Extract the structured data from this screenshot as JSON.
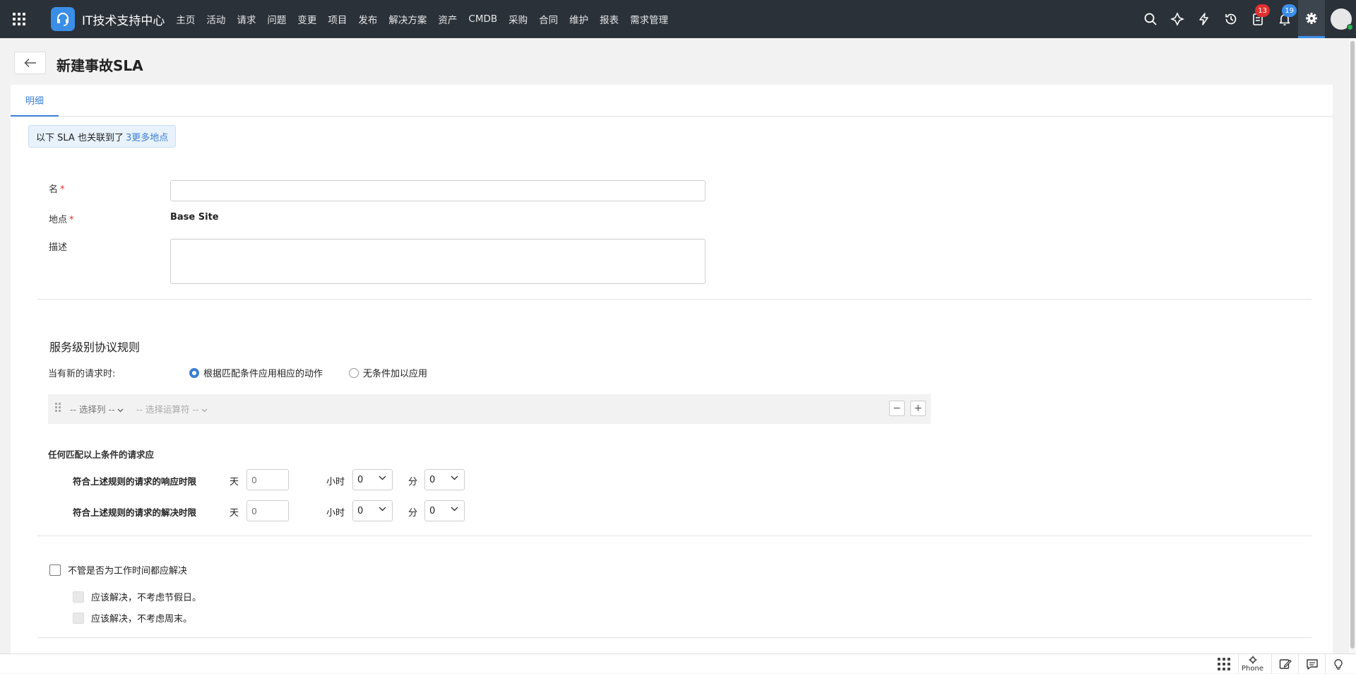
{
  "brand": "IT技术支持中心",
  "nav": [
    "主页",
    "活动",
    "请求",
    "问题",
    "变更",
    "项目",
    "发布",
    "解决方案",
    "资产",
    "CMDB",
    "采购",
    "合同",
    "维护",
    "报表",
    "需求管理"
  ],
  "badges": {
    "tasks": "13",
    "notifications": "19"
  },
  "page_title": "新建事故SLA",
  "tab_label": "明细",
  "notice": {
    "text": "以下 SLA 也关联到了",
    "link": "3更多地点"
  },
  "form": {
    "name_label": "名",
    "site_label": "地点",
    "site_value": "Base Site",
    "description_label": "描述",
    "required_mark": "*"
  },
  "rules": {
    "title": "服务级别协议规则",
    "when_label": "当有新的请求时:",
    "options": [
      "根据匹配条件应用相应的动作",
      "无条件加以应用"
    ],
    "selected_option": 0,
    "column_placeholder": "-- 选择列 --",
    "operator_placeholder": "-- 选择运算符 --",
    "match_label": "任何匹配以上条件的请求应",
    "response_label": "符合上述规则的请求的响应时限",
    "resolution_label": "符合上述规则的请求的解决时限",
    "day_label": "天",
    "hour_label": "小时",
    "minute_label": "分",
    "response": {
      "days": "0",
      "hours": "0",
      "minutes": "0"
    },
    "resolution": {
      "days": "0",
      "hours": "0",
      "minutes": "0"
    }
  },
  "business_hours": {
    "main_label": "不管是否为工作时间都应解决",
    "holiday_label": "应该解决，不考虑节假日。",
    "weekend_label": "应该解决，不考虑周末。"
  },
  "bottom": {
    "phone_label": "Phone"
  }
}
